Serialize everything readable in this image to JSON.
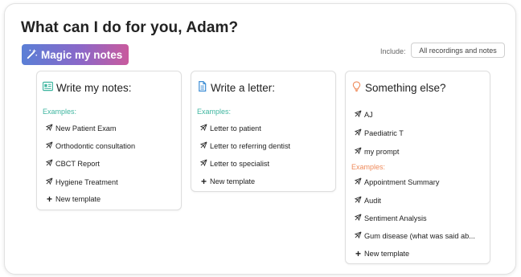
{
  "page": {
    "title": "What can I do for you, Adam?"
  },
  "magic_button": {
    "label": "Magic my notes",
    "icon": "magic-wand-icon"
  },
  "include": {
    "label": "Include:",
    "value": "All recordings and notes"
  },
  "colors": {
    "accent_green": "#3fb6a0",
    "accent_orange": "#ef8a5a",
    "gradient_start": "#5a7fd6",
    "gradient_end": "#c95a9d"
  },
  "cards": [
    {
      "title": "Write my notes:",
      "icon": "notes-card-icon",
      "examples_label": "Examples:",
      "examples": [
        "New Patient Exam",
        "Orthodontic consultation",
        "CBCT Report",
        "Hygiene Treatment"
      ],
      "new_template": "New template"
    },
    {
      "title": "Write a letter:",
      "icon": "document-icon",
      "examples_label": "Examples:",
      "examples": [
        "Letter to patient",
        "Letter to referring dentist",
        "Letter to specialist"
      ],
      "new_template": "New template"
    },
    {
      "title": "Something else?",
      "icon": "lightbulb-icon",
      "prompts": [
        "AJ",
        "Paediatric T",
        "my prompt"
      ],
      "examples_label": "Examples:",
      "examples": [
        "Appointment Summary",
        "Audit",
        "Sentiment Analysis",
        "Gum disease (what was said ab..."
      ],
      "new_template": "New template"
    }
  ]
}
